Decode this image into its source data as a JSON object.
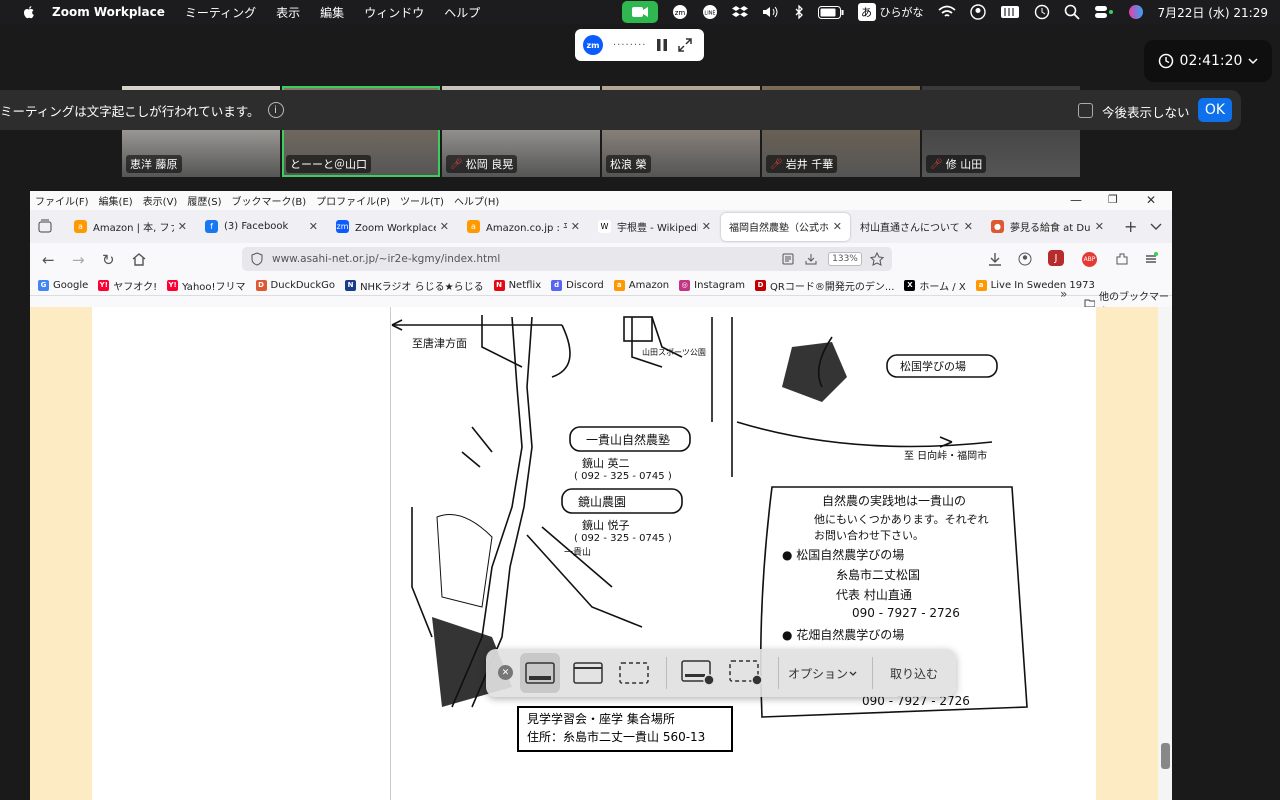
{
  "menubar": {
    "app": "Zoom Workplace",
    "items": [
      "ミーティング",
      "表示",
      "編集",
      "ウィンドウ",
      "ヘルプ"
    ],
    "ime_char": "あ",
    "ime_label": "ひらがな",
    "datetime": "7月22日 (水)  21:29"
  },
  "zoom": {
    "timer": "02:41:20",
    "mini_logo": "zm",
    "transcript_text": "ミーティングは文字起こしが行われています。",
    "transcript_info": "i",
    "checkbox_label": "今後表示しない",
    "ok_label": "OK",
    "participants": [
      {
        "name": "恵洋 藤原",
        "muted": false,
        "active": false,
        "tone": "#d9d4cc"
      },
      {
        "name": "とーーと＠山口",
        "muted": false,
        "active": true,
        "tone": "#8a7a68"
      },
      {
        "name": "松岡 良晃",
        "muted": true,
        "active": false,
        "tone": "#c9c6c0"
      },
      {
        "name": "松浪 榮",
        "muted": false,
        "active": false,
        "tone": "#b5a79a"
      },
      {
        "name": "岩井 千華",
        "muted": true,
        "active": false,
        "tone": "#7c6a55"
      },
      {
        "name": "修 山田",
        "muted": true,
        "active": false,
        "tone": "#3a3a3a"
      }
    ]
  },
  "browser": {
    "menu": [
      "ファイル(F)",
      "編集(E)",
      "表示(V)",
      "履歴(S)",
      "ブックマーク(B)",
      "プロファイル(P)",
      "ツール(T)",
      "ヘルプ(H)"
    ],
    "tabs": [
      {
        "title": "Amazon | 本, ファッ",
        "fav": "#ff9900",
        "icon": "a"
      },
      {
        "title": "(3) Facebook",
        "fav": "#1877f2",
        "icon": "f"
      },
      {
        "title": "Zoom Workplace メ",
        "fav": "#0b5cff",
        "icon": "zm"
      },
      {
        "title": "Amazon.co.jp : 平",
        "fav": "#ff9900",
        "icon": "a"
      },
      {
        "title": "宇根豊 - Wikipedia",
        "fav": "#ffffff",
        "icon": "W"
      },
      {
        "title": "福岡自然農塾（公式ホ",
        "fav": "#ffffff",
        "icon": "",
        "active": true
      },
      {
        "title": "村山直通さんについて｜",
        "fav": "#ffffff",
        "icon": ""
      },
      {
        "title": "夢見る給食 at Duck",
        "fav": "#de5833",
        "icon": "●"
      }
    ],
    "url": "www.asahi-net.or.jp/~ir2e-kgmy/index.html",
    "zoom": "133%",
    "bookmarks": [
      {
        "label": "Google",
        "color": "#4285f4",
        "icon": "G"
      },
      {
        "label": "ヤフオク!",
        "color": "#ff0033",
        "icon": "Y!"
      },
      {
        "label": "Yahoo!フリマ",
        "color": "#ff0033",
        "icon": "Y!"
      },
      {
        "label": "DuckDuckGo",
        "color": "#de5833",
        "icon": "D"
      },
      {
        "label": "NHKラジオ らじる★らじる",
        "color": "#1a3c8c",
        "icon": "N"
      },
      {
        "label": "Netflix",
        "color": "#e50914",
        "icon": "N"
      },
      {
        "label": "Discord",
        "color": "#5865f2",
        "icon": "d"
      },
      {
        "label": "Amazon",
        "color": "#ff9900",
        "icon": "a"
      },
      {
        "label": "Instagram",
        "color": "#c13584",
        "icon": "◎"
      },
      {
        "label": "QRコード®開発元のデン...",
        "color": "#c00000",
        "icon": "D"
      },
      {
        "label": "ホーム / X",
        "color": "#000000",
        "icon": "X"
      },
      {
        "label": "Live In Sweden 1973",
        "color": "#ff9900",
        "icon": "a"
      }
    ],
    "other_bookmarks": "他のブックマーク"
  },
  "map": {
    "annotation_line1": "見学学習会・座学 集合場所",
    "annotation_line2": "住所：糸島市二丈一貴山 560-13",
    "labels": {
      "school1": "一貴山自然農塾",
      "person1": "鏡山 英二",
      "phone1": "( 092 - 325 - 0745 )",
      "school2": "鏡山農園",
      "person2": "鏡山 悦子",
      "phone2": "( 092 - 325 - 0745 )",
      "matsukuni": "松国学びの場",
      "note1": "自然農の実践地は一貴山の",
      "note2": "他にもいくつかあります。それぞれ",
      "note3": "お問い合わせ下さい。",
      "note4": "● 松国自然農学びの場",
      "note5": "糸島市二丈松国",
      "note6": "代表  村山直通",
      "note7": "090 - 7927 - 2726",
      "note8": "● 花畑自然農学びの場",
      "note9": "090 - 7927 - 2726",
      "toward1": "至唐津方面",
      "toward2": "至 日向峠・福岡市",
      "park": "山田スポーツ公園",
      "kisen": "一貴山"
    }
  },
  "capture": {
    "options": "オプション",
    "capture": "取り込む"
  }
}
